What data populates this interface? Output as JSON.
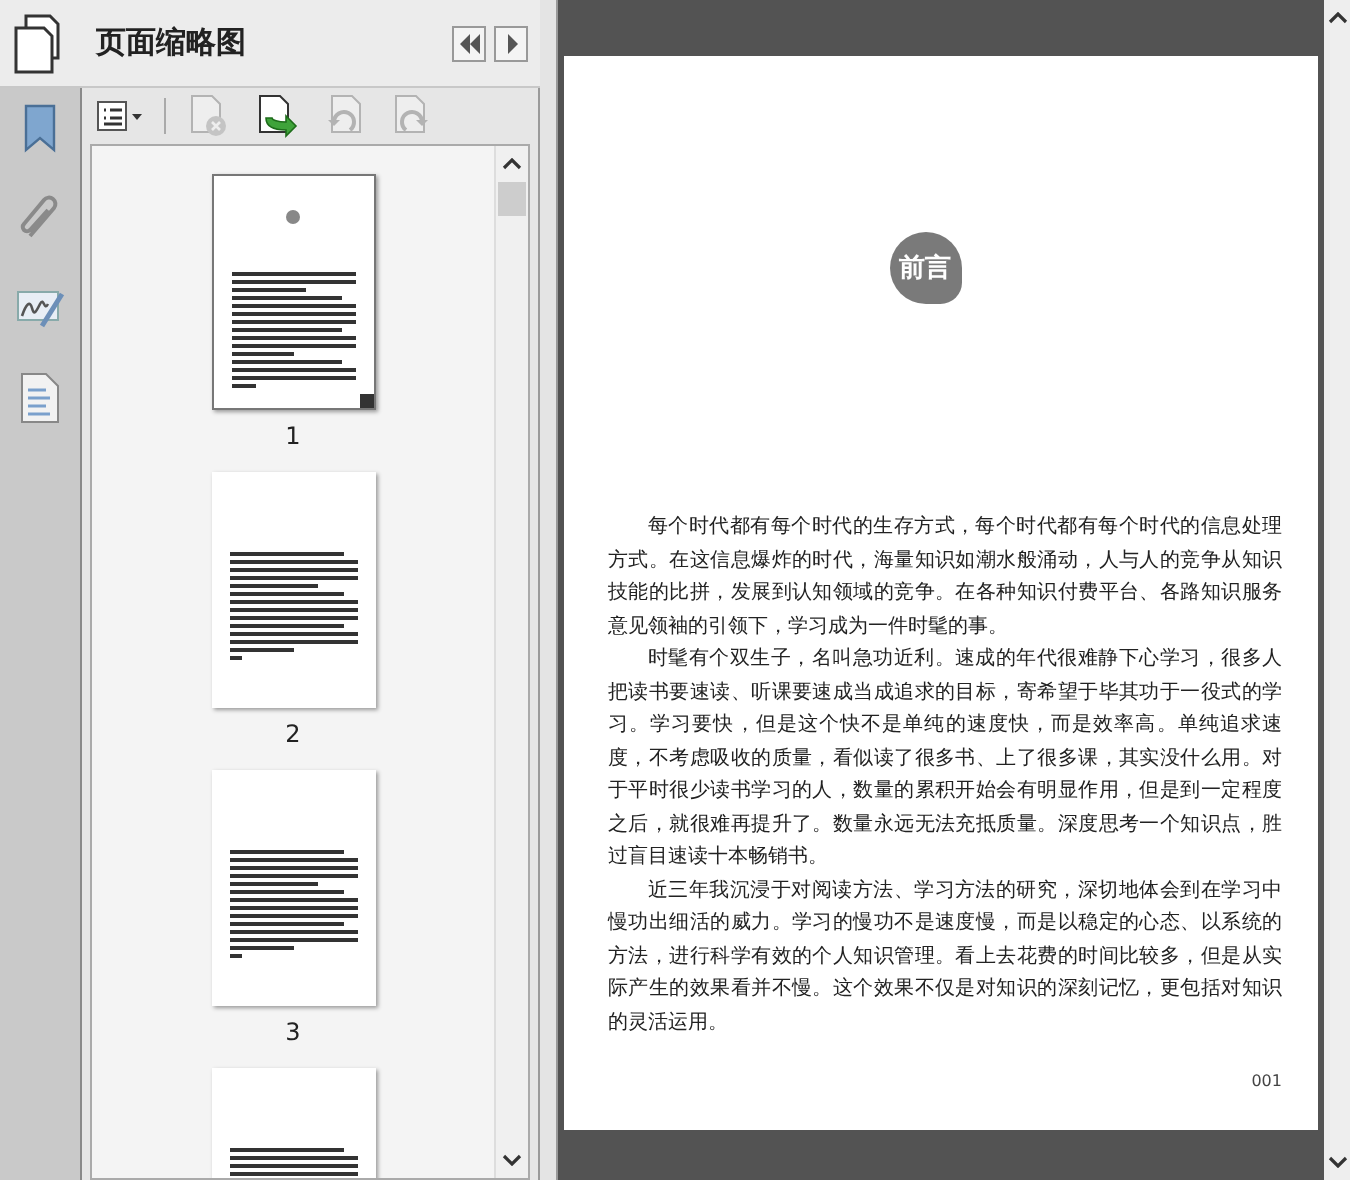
{
  "panel": {
    "title": "页面缩略图"
  },
  "toolbar": [
    {
      "kind": "options",
      "disabled": false
    },
    {
      "kind": "delete",
      "disabled": true
    },
    {
      "kind": "insert",
      "disabled": false
    },
    {
      "kind": "rotate-left",
      "disabled": true
    },
    {
      "kind": "rotate-right",
      "disabled": true
    }
  ],
  "rail": [
    {
      "kind": "bookmark"
    },
    {
      "kind": "attachment"
    },
    {
      "kind": "signature"
    },
    {
      "kind": "document"
    }
  ],
  "thumbnails": [
    {
      "label": "1",
      "selected": true,
      "kind": "preface"
    },
    {
      "label": "2",
      "selected": false,
      "kind": "text"
    },
    {
      "label": "3",
      "selected": false,
      "kind": "text"
    },
    {
      "selected": false,
      "kind": "text"
    }
  ],
  "page": {
    "badge": "前言",
    "paragraphs": [
      "每个时代都有每个时代的生存方式，每个时代都有每个时代的信息处理方式。在这信息爆炸的时代，海量知识如潮水般涌动，人与人的竞争从知识技能的比拼，发展到认知领域的竞争。在各种知识付费平台、各路知识服务意见领袖的引领下，学习成为一件时髦的事。",
      "时髦有个双生子，名叫急功近利。速成的年代很难静下心学习，很多人把读书要速读、听课要速成当成追求的目标，寄希望于毕其功于一役式的学习。学习要快，但是这个快不是单纯的速度快，而是效率高。单纯追求速度，不考虑吸收的质量，看似读了很多书、上了很多课，其实没什么用。对于平时很少读书学习的人，数量的累积开始会有明显作用，但是到一定程度之后，就很难再提升了。数量永远无法充抵质量。深度思考一个知识点，胜过盲目速读十本畅销书。",
      "近三年我沉浸于对阅读方法、学习方法的研究，深切地体会到在学习中慢功出细活的威力。学习的慢功不是速度慢，而是以稳定的心态、以系统的方法，进行科学有效的个人知识管理。看上去花费的时间比较多，但是从实际产生的效果看并不慢。这个效果不仅是对知识的深刻记忆，更包括对知识的灵活运用。"
    ],
    "page_number": "001"
  }
}
